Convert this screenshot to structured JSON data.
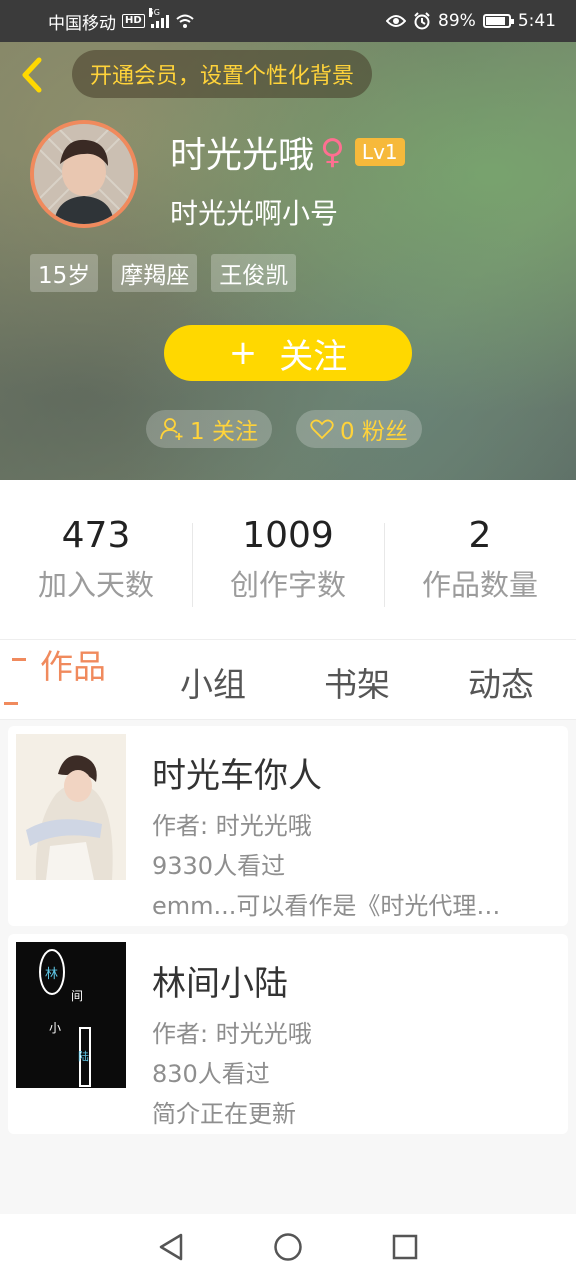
{
  "status_bar": {
    "carrier": "中国移动",
    "hd": "HD",
    "network": "5G",
    "battery": "89%",
    "battery_level": 0.89,
    "time": "5:41"
  },
  "header": {
    "vip_banner": "开通会员，设置个性化背景",
    "username": "时光光哦",
    "gender_symbol": "♀",
    "level": "Lv1",
    "nickname": "时光光啊小号",
    "tags": [
      "15岁",
      "摩羯座",
      "王俊凯"
    ],
    "follow_plus": "+",
    "follow_label": "关注",
    "following": "1 关注",
    "fans": "0 粉丝",
    "icons": {
      "back": "back-chevron-icon",
      "following": "user-plus-icon",
      "fans": "heart-icon"
    },
    "accent": "#ffd800"
  },
  "stats": [
    {
      "value": "473",
      "label": "加入天数"
    },
    {
      "value": "1009",
      "label": "创作字数"
    },
    {
      "value": "2",
      "label": "作品数量"
    }
  ],
  "tabs": [
    "作品",
    "小组",
    "书架",
    "动态"
  ],
  "works": [
    {
      "title": "时光车你人",
      "author": "作者: 时光光哦",
      "views": "9330人看过",
      "desc": "emm...可以看作是《时光代理…"
    },
    {
      "title": "林间小陆",
      "author": "作者: 时光光哦",
      "views": "830人看过",
      "desc": "简介正在更新",
      "cover_text": [
        "林",
        "间",
        "小",
        "陆"
      ]
    }
  ],
  "nav": {
    "back": "triangle-back-icon",
    "home": "circle-home-icon",
    "recent": "square-recent-icon"
  }
}
